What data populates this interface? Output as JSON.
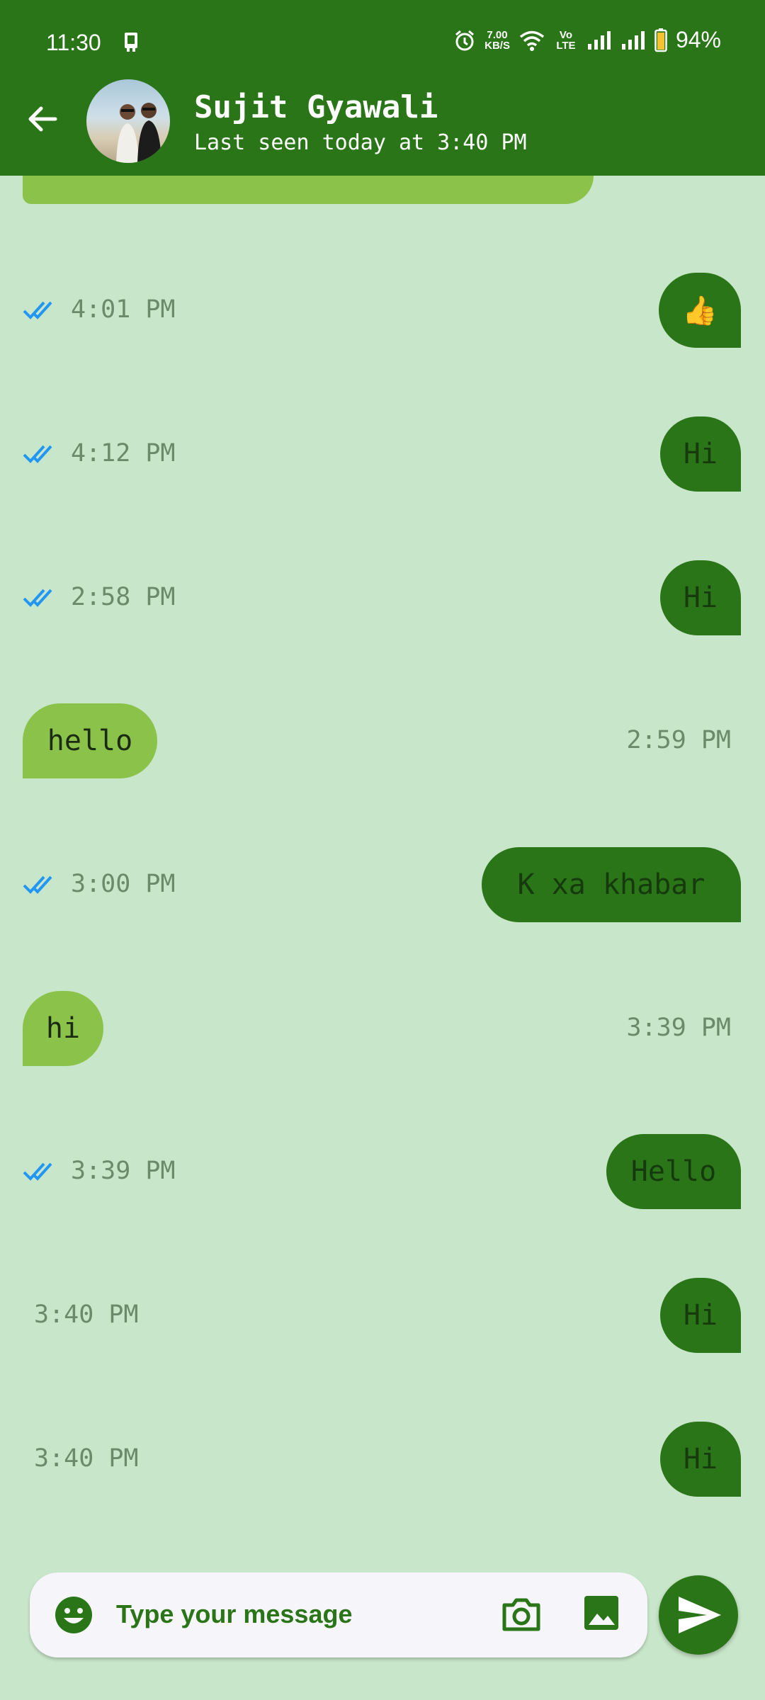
{
  "status_bar": {
    "time": "11:30",
    "speed_value": "7.00",
    "speed_unit": "KB/S",
    "network": "Vo LTE",
    "battery": "94%",
    "icons": [
      "alarm-icon",
      "wifi-icon",
      "signal-icon",
      "battery-icon"
    ]
  },
  "header": {
    "contact_name": "Sujit Gyawali",
    "last_seen": "Last seen today at 3:40 PM",
    "back_icon": "arrow-back-icon"
  },
  "messages": [
    {
      "direction": "out",
      "text": "👍",
      "time": "4:01 PM",
      "read": true
    },
    {
      "direction": "out",
      "text": "Hi",
      "time": "4:12 PM",
      "read": true
    },
    {
      "direction": "out",
      "text": "Hi",
      "time": "2:58 PM",
      "read": true
    },
    {
      "direction": "in",
      "text": "hello",
      "time": "2:59 PM"
    },
    {
      "direction": "out",
      "text": "K xa khabar",
      "time": "3:00 PM",
      "read": true
    },
    {
      "direction": "in",
      "text": "hi",
      "time": "3:39 PM"
    },
    {
      "direction": "out",
      "text": "Hello",
      "time": "3:39 PM",
      "read": true
    },
    {
      "direction": "out",
      "text": "Hi",
      "time": "3:40 PM",
      "read": false
    },
    {
      "direction": "out",
      "text": "Hi",
      "time": "3:40 PM",
      "read": false
    }
  ],
  "composer": {
    "placeholder": "Type your message"
  },
  "colors": {
    "primary": "#2a7518",
    "incoming_bubble": "#8bc34a",
    "background": "#c8e6c9",
    "read_ticks": "#2196f3"
  }
}
